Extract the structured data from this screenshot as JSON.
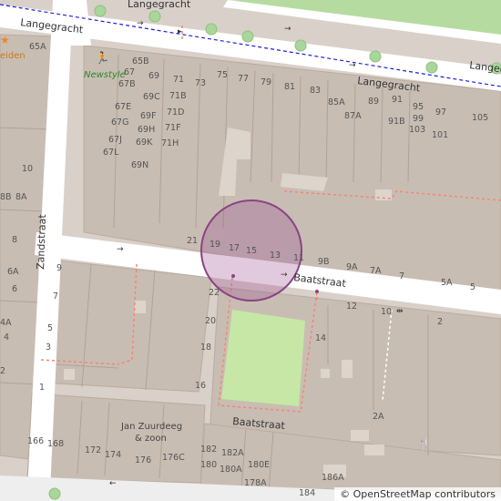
{
  "streets": {
    "langegracht_1": "Langegracht",
    "langegracht_2": "Langegracht",
    "langegracht_3": "Langegracht",
    "langegracht_4": "Langegracht",
    "zandstraat": "Zandstraat",
    "baatstraat_1": "Baatstraat",
    "baatstraat_2": "Baatstraat"
  },
  "pois": {
    "newstyle": "Newstyle",
    "leiden": "eiden",
    "jan_line1": "Jan Zuurdeeg",
    "jan_line2": "& zoon"
  },
  "house_numbers": {
    "n65A": "65A",
    "n65B": "65B",
    "n67": "67",
    "n67B": "67B",
    "n69": "69",
    "n71": "71",
    "n75": "75",
    "n77": "77",
    "n79": "79",
    "n81": "81",
    "n83": "83",
    "n73": "73",
    "n85A": "85A",
    "n89": "89",
    "n91": "91",
    "n95": "95",
    "n99": "99",
    "n97": "97",
    "n105": "105",
    "n87A": "87A",
    "n91B": "91B",
    "n103": "103",
    "n101": "101",
    "n69C": "69C",
    "n71B": "71B",
    "n67E": "67E",
    "n69F": "69F",
    "n71D": "71D",
    "n67G": "67G",
    "n69H": "69H",
    "n71F": "71F",
    "n67J": "67J",
    "n69K": "69K",
    "n71H": "71H",
    "n67L": "67L",
    "n69N": "69N",
    "n10": "10",
    "n8B": "8B",
    "n8A": "8A",
    "n8": "8",
    "n6A": "6A",
    "n6": "6",
    "n4A": "4A",
    "n4": "4",
    "n2": "2",
    "n21": "21",
    "n19": "19",
    "n17": "17",
    "n15": "15",
    "n13": "13",
    "n11": "11",
    "n9B": "9B",
    "n9A": "9A",
    "n7A": "7A",
    "n7": "7",
    "n5A": "5A",
    "n5": "5",
    "w9": "9",
    "w7": "7",
    "w5": "5",
    "w3": "3",
    "w1": "1",
    "n22": "22",
    "n20": "20",
    "n18": "18",
    "n16": "16",
    "n14": "14",
    "n12": "12",
    "n10b": "10",
    "e2": "2",
    "n2A": "2A",
    "n166": "166",
    "n168": "168",
    "n172": "172",
    "n174": "174",
    "n176": "176",
    "n176C": "176C",
    "n182": "182",
    "n182A": "182A",
    "n180": "180",
    "n180E": "180E",
    "n180A": "180A",
    "n178A": "178A",
    "n186A": "186A",
    "n184": "184"
  },
  "attribution": "© OpenStreetMap contributors",
  "colors": {
    "background": "#d9d0c9",
    "building": "#c8bdb3",
    "road": "#ffffff",
    "park": "#c7e7a6",
    "footway": "#fa8072",
    "path_dash": "#1f1fd6",
    "tree": "#a9d69a",
    "highlight": "#9b4d92"
  }
}
